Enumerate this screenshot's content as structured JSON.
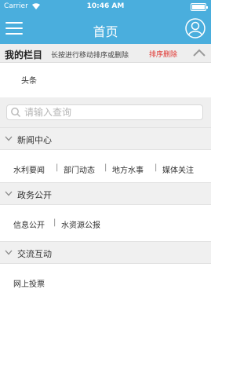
{
  "status_bar": {
    "carrier": "Carrier",
    "time": "10:46 AM"
  },
  "nav": {
    "title": "首页"
  },
  "columns": {
    "title": "我的栏目",
    "hint": "长按进行移动排序或删除",
    "sort_delete": "排序删除",
    "tags": [
      "头条"
    ]
  },
  "search": {
    "placeholder": "请输入查询",
    "value": ""
  },
  "sections": [
    {
      "title": "新闻中心",
      "items": [
        "水利要闻",
        "部门动态",
        "地方水事",
        "媒体关注"
      ]
    },
    {
      "title": "政务公开",
      "items": [
        "信息公开",
        "水资源公报"
      ]
    },
    {
      "title": "交流互动",
      "items": [
        "网上投票"
      ]
    }
  ],
  "colors": {
    "primary": "#4aaedd",
    "accent": "#e0322d",
    "section_bg": "#f0f0f0"
  }
}
